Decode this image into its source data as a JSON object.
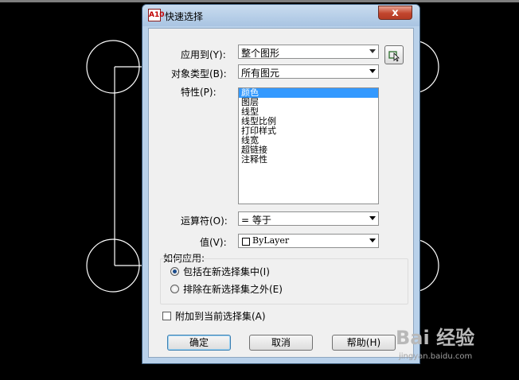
{
  "dialog": {
    "app_icon_text": "A10",
    "title": "快速选择",
    "close_label": "x"
  },
  "form": {
    "apply_to_label": "应用到(Y):",
    "apply_to_value": "整个图形",
    "object_type_label": "对象类型(B):",
    "object_type_value": "所有图元",
    "properties_label": "特性(P):",
    "properties": [
      "颜色",
      "图层",
      "线型",
      "线型比例",
      "打印样式",
      "线宽",
      "超链接",
      "注释性"
    ],
    "selected_property": "颜色",
    "operator_label": "运算符(O):",
    "operator_value": "= 等于",
    "value_label": "值(V):",
    "value_value": "ByLayer",
    "how_apply_label": "如何应用:",
    "include_label": "包括在新选择集中(I)",
    "exclude_label": "排除在新选择集之外(E)",
    "append_label": "附加到当前选择集(A)"
  },
  "buttons": {
    "ok": "确定",
    "cancel": "取消",
    "help": "帮助(H)"
  },
  "watermark": {
    "logo": "Bai 经验",
    "url": "jingyan.baidu.com"
  },
  "colors": {
    "selection": "#3399ff",
    "dialog_frame": "#b9d1ea",
    "close_button": "#c2452d"
  }
}
